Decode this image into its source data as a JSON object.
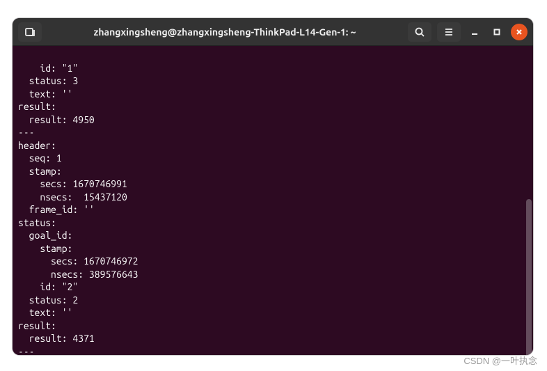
{
  "titlebar": {
    "title": "zhangxingsheng@zhangxingsheng-ThinkPad-L14-Gen-1: ~"
  },
  "terminal": {
    "lines": [
      "    id: \"1\"",
      "  status: 3",
      "  text: ''",
      "result:",
      "  result: 4950",
      "---",
      "header:",
      "  seq: 1",
      "  stamp:",
      "    secs: 1670746991",
      "    nsecs:  15437120",
      "  frame_id: ''",
      "status:",
      "  goal_id:",
      "    stamp:",
      "      secs: 1670746972",
      "      nsecs: 389576643",
      "    id: \"2\"",
      "  status: 2",
      "  text: ''",
      "result:",
      "  result: 4371",
      "---"
    ]
  },
  "watermark": "CSDN @一叶执念"
}
